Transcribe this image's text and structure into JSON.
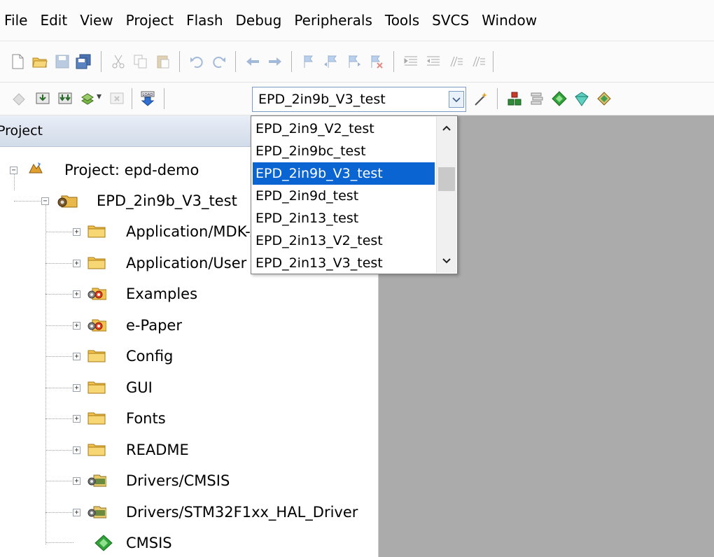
{
  "menu": [
    "File",
    "Edit",
    "View",
    "Project",
    "Flash",
    "Debug",
    "Peripherals",
    "Tools",
    "SVCS",
    "Window"
  ],
  "target": {
    "selected": "EPD_2in9b_V3_test",
    "options": [
      "EPD_2in9_V2_test",
      "EPD_2in9bc_test",
      "EPD_2in9b_V3_test",
      "EPD_2in9d_test",
      "EPD_2in13_test",
      "EPD_2in13_V2_test",
      "EPD_2in13_V3_test"
    ],
    "selected_index": 2
  },
  "project_panel": {
    "title": "Project",
    "root": "Project: epd-demo",
    "target_node": "EPD_2in9b_V3_test",
    "groups": [
      {
        "label": "Application/MDK-ARM",
        "icon": "folder-icon"
      },
      {
        "label": "Application/User",
        "icon": "folder-icon"
      },
      {
        "label": "Examples",
        "icon": "folder-settings-icon"
      },
      {
        "label": "e-Paper",
        "icon": "folder-settings-icon"
      },
      {
        "label": "Config",
        "icon": "folder-icon"
      },
      {
        "label": "GUI",
        "icon": "folder-icon"
      },
      {
        "label": "Fonts",
        "icon": "folder-icon"
      },
      {
        "label": "README",
        "icon": "folder-icon"
      },
      {
        "label": "Drivers/CMSIS",
        "icon": "folder-gear-icon"
      },
      {
        "label": "Drivers/STM32F1xx_HAL_Driver",
        "icon": "folder-gear-icon"
      },
      {
        "label": "CMSIS",
        "icon": "green-diamond-icon"
      }
    ]
  },
  "colors": {
    "selection": "#0a64d2",
    "editor_bg": "#ababab",
    "header_gradient_top": "#e9eef7",
    "header_gradient_bottom": "#d2dbe9"
  }
}
